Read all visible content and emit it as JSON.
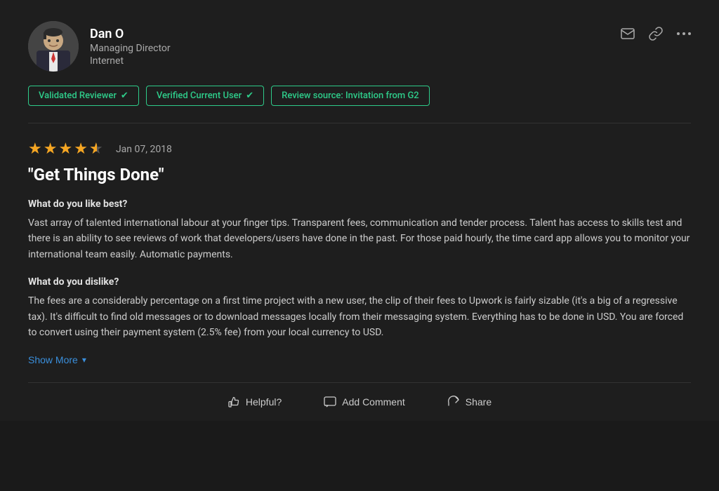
{
  "header": {
    "user_name": "Dan O",
    "user_title": "Managing Director",
    "user_company": "Internet"
  },
  "badges": [
    {
      "id": "validated",
      "label": "Validated Reviewer"
    },
    {
      "id": "verified",
      "label": "Verified Current User"
    },
    {
      "id": "source",
      "label": "Review source: Invitation from G2"
    }
  ],
  "review": {
    "date": "Jan 07, 2018",
    "stars": 4.5,
    "title": "\"Get Things Done\"",
    "sections": [
      {
        "id": "like",
        "label": "What do you like best?",
        "text": "Vast array of talented international labour at your finger tips. Transparent fees, communication and tender process. Talent has access to skills test and there is an ability to see reviews of work that developers/users have done in the past. For those paid hourly, the time card app allows you to monitor your international team easily. Automatic payments."
      },
      {
        "id": "dislike",
        "label": "What do you dislike?",
        "text": "The fees are a considerably percentage on a first time project with a new user, the clip of their fees to Upwork is fairly sizable (it's a big of a regressive tax). It's difficult to find old messages or to download messages locally from their messaging system. Everything has to be done in USD. You are forced to convert using their payment system (2.5% fee) from your local currency to USD."
      }
    ],
    "show_more_label": "Show More"
  },
  "footer_actions": [
    {
      "id": "helpful",
      "label": "Helpful?"
    },
    {
      "id": "comment",
      "label": "Add Comment"
    },
    {
      "id": "share",
      "label": "Share"
    }
  ],
  "icons": {
    "mail": "✉",
    "link": "🔗",
    "more": "•••",
    "chevron_down": "▾",
    "checkmark": "✔"
  }
}
